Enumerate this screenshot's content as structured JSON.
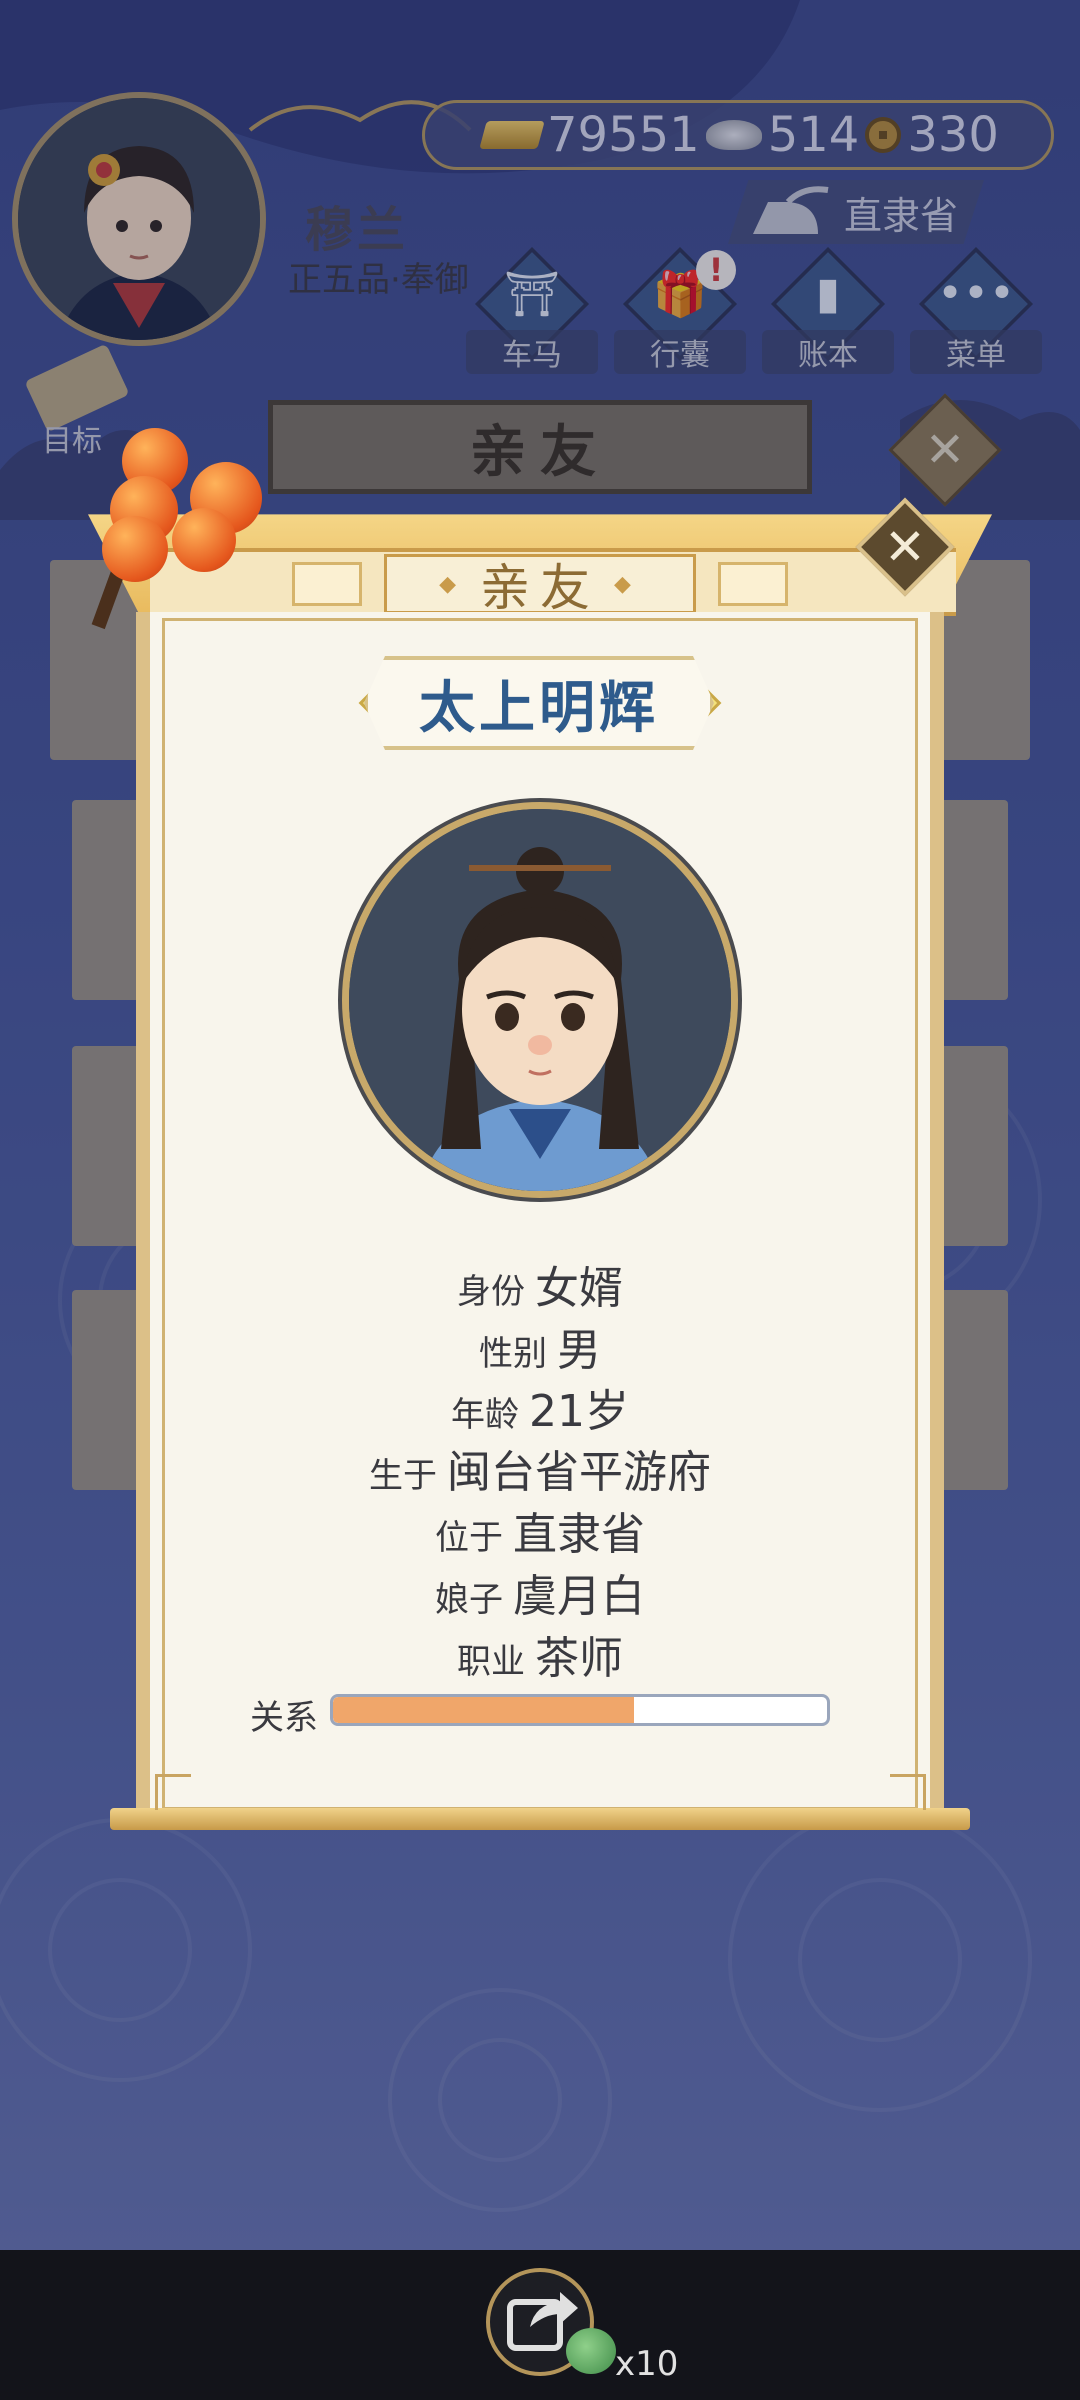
{
  "player": {
    "name": "穆兰",
    "rank": "正五品·奉御"
  },
  "currency": {
    "gold": "79551",
    "silver": "514",
    "coins": "330"
  },
  "location": "直隶省",
  "menu": {
    "carriage": "车马",
    "bag": "行囊",
    "ledger": "账本",
    "menu": "菜单",
    "goal": "目标"
  },
  "background_panel": {
    "title": "亲友"
  },
  "dialog": {
    "title": "亲友",
    "person_name": "太上明辉",
    "fields": [
      {
        "key": "身份",
        "value": "女婿"
      },
      {
        "key": "性别",
        "value": "男"
      },
      {
        "key": "年龄",
        "value": "21岁"
      },
      {
        "key": "生于",
        "value": "闽台省平游府"
      },
      {
        "key": "位于",
        "value": "直隶省"
      },
      {
        "key": "娘子",
        "value": "虞月白"
      },
      {
        "key": "职业",
        "value": "茶师"
      }
    ],
    "relation_label": "关系",
    "relation_percent": 61,
    "close_symbol": "✕"
  },
  "footer": {
    "share_count": "x10"
  },
  "colors": {
    "accent_gold": "#c99b4a",
    "name_blue": "#2e5b8c",
    "relation_fill": "#f0a66a"
  }
}
